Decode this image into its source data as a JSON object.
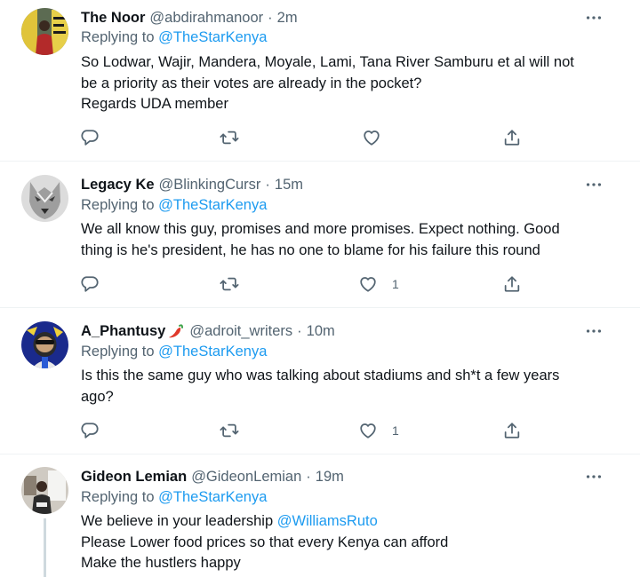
{
  "tweets": [
    {
      "name": "The Noor",
      "handle": "@abdirahmanoor",
      "time": "2m",
      "replying_label": "Replying to ",
      "replying_handle": "@TheStarKenya",
      "lines": [
        "So Lodwar, Wajir, Mandera, Moyale, Lami, Tana River Samburu et al will not",
        "be a priority as their votes are already in the pocket?",
        "Regards UDA member"
      ],
      "like_count": ""
    },
    {
      "name": "Legacy Ke",
      "handle": "@BlinkingCursr",
      "time": "15m",
      "replying_label": "Replying to ",
      "replying_handle": "@TheStarKenya",
      "lines": [
        "We all know this guy, promises and more promises. Expect nothing. Good",
        "thing is he's president, he has no one to blame for his failure this round"
      ],
      "like_count": "1"
    },
    {
      "name": "A_Phantusy",
      "handle": "@adroit_writers",
      "time": "10m",
      "replying_label": "Replying to ",
      "replying_handle": "@TheStarKenya",
      "lines": [
        "Is this the same guy who was talking about stadiums and sh*t a few years",
        "ago?"
      ],
      "like_count": "1"
    },
    {
      "name": "Gideon Lemian",
      "handle": "@GideonLemian",
      "time": "19m",
      "replying_label": "Replying to ",
      "replying_handle": "@TheStarKenya",
      "line1_text": "We believe in your leadership ",
      "line1_mention": "@WilliamsRuto",
      "lines": [
        "Please Lower food prices so that every Kenya can afford",
        "Make the hustlers happy"
      ]
    }
  ],
  "separator": "·",
  "icons": {
    "more": "more-horizontal-icon",
    "reply": "reply-icon",
    "retweet": "retweet-icon",
    "like": "like-icon",
    "share": "share-icon",
    "emoji": "chili-pepper-emoji"
  },
  "colors": {
    "link": "#1d9bf0",
    "secondary_text": "#536471",
    "primary_text": "#0f1419",
    "divider": "#eff3f4"
  }
}
